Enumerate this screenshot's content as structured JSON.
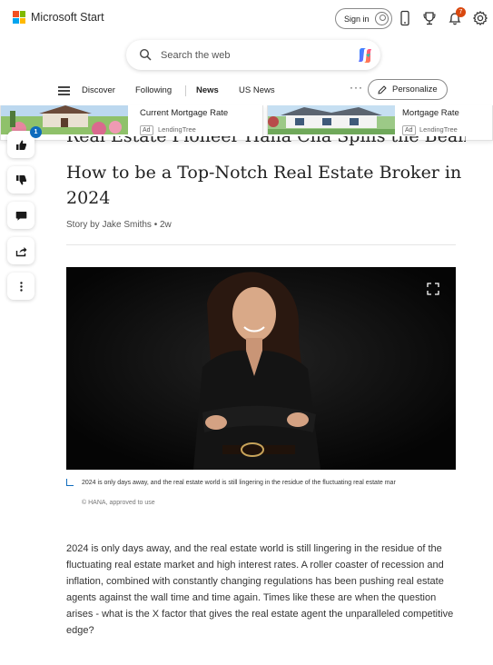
{
  "header": {
    "brand": "Microsoft Start",
    "sign_in": "Sign in",
    "notification_count": "7",
    "brand_colors": [
      "#f25022",
      "#7fba00",
      "#00a4ef",
      "#ffb900"
    ]
  },
  "search": {
    "placeholder": "Search the web"
  },
  "nav": {
    "items": [
      {
        "label": "Discover",
        "active": false
      },
      {
        "label": "Following",
        "active": false
      },
      {
        "label": "News",
        "active": true
      },
      {
        "label": "US News",
        "active": false
      }
    ],
    "more": "···",
    "personalize": "Personalize"
  },
  "ads": [
    {
      "title": "Current Mortgage Rate",
      "tag": "Ad",
      "source": "LendingTree"
    },
    {
      "title": "Mortgage Rate",
      "tag": "Ad",
      "source": "LendingTree"
    }
  ],
  "rail": {
    "like_count": "1"
  },
  "article": {
    "headline_partial": "Real Estate Pioneer Hana Cha Spills the Beans on",
    "headline": "How to be a Top-Notch Real Estate Broker in 2024",
    "byline": "Story by Jake Smiths • 2w",
    "caption": "2024 is only days away, and the real estate world is still lingering in the residue of the fluctuating real estate mar",
    "credit": "© HANA, approved to use",
    "body": "2024 is only days away, and the real estate world is still lingering in the residue of the fluctuating real estate market and high interest rates. A roller coaster of recession and inflation, combined with constantly changing regulations has been pushing real estate agents against the wall time and time again. Times like these are when the question arises - what is the X factor that gives the real estate agent the unparalleled competitive edge?"
  },
  "accent_color": "#0f6cbd"
}
